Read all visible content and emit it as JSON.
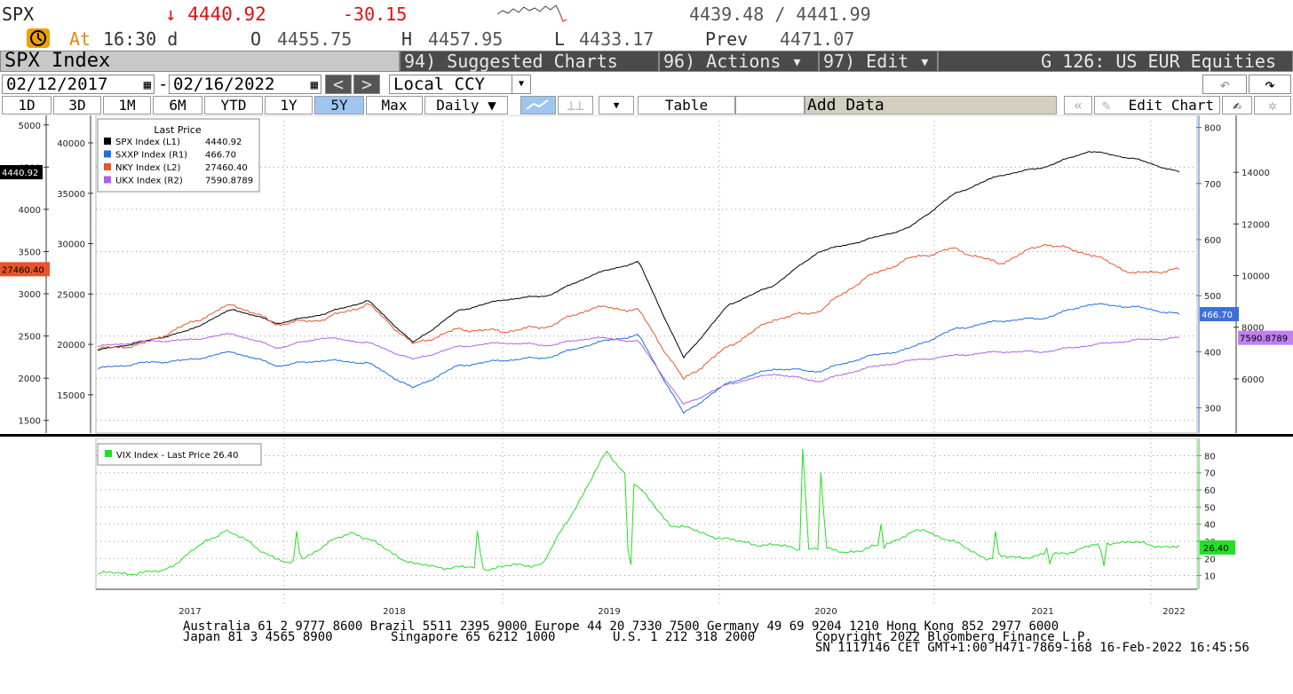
{
  "quote": {
    "ticker": "SPX",
    "last": "4440.92",
    "change": "-30.15",
    "bid_ask": "4439.48 / 4441.99",
    "at_label": "At",
    "time": "16:30 d",
    "open_label": "O",
    "open": "4455.75",
    "high_label": "H",
    "high": "4457.95",
    "low_label": "L",
    "low": "4433.17",
    "prev_label": "Prev",
    "prev": "4471.07"
  },
  "toolbar": {
    "security": "SPX Index",
    "suggested": "94) Suggested Charts",
    "actions": "96) Actions ▾",
    "edit": "97) Edit ▾",
    "group": "G 126: US EUR Equities",
    "start_date": "02/12/2017",
    "end_date": "02/16/2022",
    "date_sep": "-",
    "currency": "Local CCY",
    "ranges": [
      "1D",
      "3D",
      "1M",
      "6M",
      "YTD",
      "1Y",
      "5Y",
      "Max"
    ],
    "selected_range": "5Y",
    "frequency": "Daily ▼",
    "table": "Table",
    "add_data": "Add Data",
    "edit_chart": "Edit Chart"
  },
  "colors": {
    "spx": "#000000",
    "sxxp": "#1a6fe0",
    "nky": "#e8542a",
    "ukx": "#b060e8",
    "vix": "#22e022",
    "accent": "#3a70d8"
  },
  "chart_data": [
    {
      "type": "line",
      "legend_title": "Last Price",
      "legend_position": "top-left",
      "grid": true,
      "x": [
        "2017-02",
        "2017-06",
        "2017-10",
        "2018-01",
        "2018-02",
        "2018-06",
        "2018-09",
        "2018-12",
        "2019-03",
        "2019-06",
        "2019-09",
        "2019-12",
        "2020-02",
        "2020-03",
        "2020-04",
        "2020-06",
        "2020-09",
        "2020-11",
        "2021-01",
        "2021-04",
        "2021-07",
        "2021-09",
        "2021-11",
        "2022-01",
        "2022-02"
      ],
      "xticks": [
        "2017",
        "2018",
        "2019",
        "2020",
        "2021",
        "2022"
      ],
      "axes": {
        "L1": {
          "ticks": [
            1500,
            2000,
            2500,
            3000,
            3500,
            4000,
            4500,
            5000
          ]
        },
        "L2": {
          "ticks": [
            15000,
            20000,
            25000,
            30000,
            35000,
            40000
          ]
        },
        "R1": {
          "ticks": [
            300,
            400,
            500,
            600,
            700,
            800
          ]
        },
        "R2": {
          "ticks": [
            6000,
            8000,
            10000,
            12000,
            14000
          ]
        }
      },
      "series": [
        {
          "name": "SPX Index",
          "axis": "L1",
          "last": "4440.92",
          "values": [
            2330,
            2430,
            2560,
            2820,
            2650,
            2760,
            2920,
            2420,
            2800,
            2930,
            2980,
            3230,
            3380,
            2240,
            2870,
            3100,
            3500,
            3630,
            3780,
            4180,
            4400,
            4500,
            4690,
            4600,
            4440
          ]
        },
        {
          "name": "SXXP Index",
          "axis": "R1",
          "last": "466.70",
          "values": [
            370,
            380,
            385,
            400,
            375,
            385,
            380,
            335,
            375,
            385,
            390,
            415,
            430,
            290,
            345,
            370,
            365,
            390,
            405,
            440,
            455,
            460,
            485,
            480,
            467
          ]
        },
        {
          "name": "NKY Index",
          "axis": "L2",
          "last": "27460.40",
          "values": [
            19500,
            20000,
            22000,
            24000,
            22000,
            22500,
            24000,
            20000,
            21500,
            21300,
            21800,
            23700,
            23400,
            16500,
            19800,
            22500,
            23300,
            26500,
            28500,
            29500,
            28000,
            30000,
            29000,
            27000,
            27460
          ]
        },
        {
          "name": "UKX Index",
          "axis": "R2",
          "last": "7590.8789",
          "values": [
            7250,
            7450,
            7500,
            7750,
            7200,
            7600,
            7400,
            6750,
            7250,
            7400,
            7300,
            7600,
            7450,
            5000,
            5800,
            6200,
            5900,
            6400,
            6700,
            6900,
            7050,
            7050,
            7300,
            7500,
            7590
          ]
        }
      ]
    },
    {
      "type": "line",
      "legend_position": "top-left",
      "grid": true,
      "axes": {
        "R": {
          "ticks": [
            10,
            20,
            30,
            40,
            50,
            60,
            70,
            80
          ]
        }
      },
      "x": [
        "2017-02",
        "2017-08",
        "2018-02",
        "2018-06",
        "2018-12",
        "2019-06",
        "2019-12",
        "2020-02",
        "2020-03",
        "2020-04",
        "2020-06",
        "2020-09",
        "2020-11",
        "2021-01",
        "2021-05",
        "2021-09",
        "2021-12",
        "2022-02"
      ],
      "series": [
        {
          "name": "VIX Index - Last Price 26.40",
          "last": "26.40",
          "values": [
            11,
            12,
            37,
            16,
            36,
            16,
            14,
            17,
            82,
            40,
            30,
            26,
            24,
            37,
            20,
            22,
            30,
            26.4
          ]
        }
      ]
    }
  ],
  "footer": {
    "line1": "Australia 61 2 9777 8600 Brazil 5511 2395 9000 Europe 44 20 7330 7500 Germany 49 69 9204 1210 Hong Kong 852 2977 6000",
    "line2a": "Japan 81 3 4565 8900",
    "line2b": "Singapore 65 6212 1000",
    "line2c": "U.S. 1 212 318 2000",
    "line2d": "Copyright 2022 Bloomberg Finance L.P.",
    "line3": "SN 1117146 CET  GMT+1:00 H471-7869-168 16-Feb-2022 16:45:56"
  }
}
